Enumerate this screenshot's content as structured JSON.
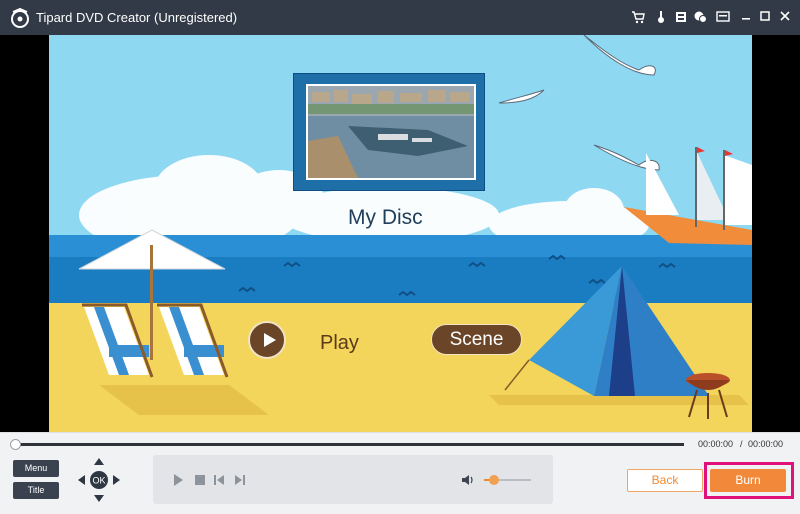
{
  "window": {
    "title": "Tipard DVD Creator (Unregistered)"
  },
  "titlebar_icons": [
    "cart-icon",
    "key-icon",
    "register-icon",
    "chat-icon",
    "menu-icon",
    "minimize-icon",
    "maximize-icon",
    "close-icon"
  ],
  "menu_preview": {
    "disc_title": "My Disc",
    "play_label": "Play",
    "scene_label": "Scene"
  },
  "playback": {
    "progress": 0,
    "time_current": "00:00:00",
    "time_separator": "/",
    "time_total": "00:00:00",
    "volume": 0.2
  },
  "side_buttons": {
    "menu": "Menu",
    "title": "Title"
  },
  "dpad": {
    "center": "OK"
  },
  "footer": {
    "back": "Back",
    "burn": "Burn"
  },
  "colors": {
    "accent": "#f2893a",
    "highlight": "#e0117a",
    "titlebar": "#313a46"
  }
}
